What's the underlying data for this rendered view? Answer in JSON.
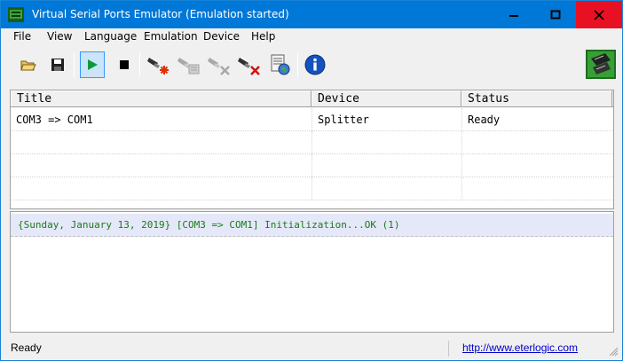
{
  "window": {
    "title": "Virtual Serial Ports Emulator (Emulation started)"
  },
  "menu": [
    "File",
    "View",
    "Language",
    "Emulation",
    "Device",
    "Help"
  ],
  "toolbar": {
    "buttons": [
      {
        "name": "open-icon"
      },
      {
        "name": "save-icon"
      },
      {
        "name": "start-emulation-icon"
      },
      {
        "name": "stop-emulation-icon"
      },
      {
        "name": "create-device-icon"
      },
      {
        "name": "edit-device-icon"
      },
      {
        "name": "disable-device-icon"
      },
      {
        "name": "delete-device-icon"
      },
      {
        "name": "network-settings-icon"
      },
      {
        "name": "about-info-icon"
      }
    ]
  },
  "ports": {
    "columns": [
      "Title",
      "Device",
      "Status"
    ],
    "rows": [
      {
        "title": "COM3 => COM1",
        "device": "Splitter",
        "status": "Ready"
      }
    ]
  },
  "log": [
    "{Sunday, January 13, 2019} [COM3 => COM1] Initialization...OK (1)"
  ],
  "status": {
    "text": "Ready",
    "link": "http://www.eterlogic.com"
  },
  "colors": {
    "titlebar": "#0078d7",
    "close": "#e81123",
    "log_text": "#1a7a1a",
    "link": "#0000cc"
  }
}
